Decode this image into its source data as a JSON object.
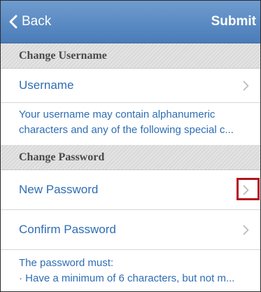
{
  "navbar": {
    "back_label": "Back",
    "submit_label": "Submit"
  },
  "sections": {
    "username": {
      "header": "Change Username",
      "row_label": "Username",
      "note_line1": "Your username may contain alphanumeric",
      "note_line2": "characters and any of the following special c..."
    },
    "password": {
      "header": "Change Password",
      "new_label": "New Password",
      "confirm_label": "Confirm Password",
      "note_line1": "The password must:",
      "note_line2": "· Have a minimum of 6 characters, but not m..."
    }
  },
  "icons": {
    "back": "chevron-left-icon",
    "disclosure": "chevron-right-icon"
  },
  "colors": {
    "nav_bar": "#5a8bc4",
    "link_text": "#2e6db4",
    "highlight": "#b4141e"
  }
}
